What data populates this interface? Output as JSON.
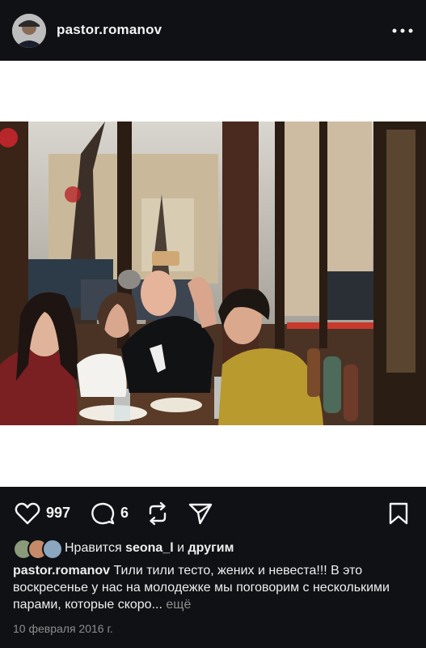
{
  "header": {
    "username": "pastor.romanov",
    "avatar_icon": "avatar-icon",
    "more_icon": "more-horizontal-icon"
  },
  "post": {
    "image_icon": "photo-selfie-restaurant",
    "actions": {
      "like_count": "997",
      "comment_count": "6"
    },
    "likes": {
      "prefix": "Нравится",
      "user": "seona_l",
      "middle": "и",
      "suffix": "другим"
    },
    "caption": {
      "author": "pastor.romanov",
      "text": "Тили тили тесто, жених и невеста!!! В это воскресенье у нас на молодежке мы поговорим с несколькими парами, которые скоро...",
      "more": "ещё"
    },
    "date": "10 февраля 2016 г."
  },
  "colors": {
    "background": "#0f1115",
    "text": "#f5f5f5",
    "muted": "#8e8e8e"
  }
}
